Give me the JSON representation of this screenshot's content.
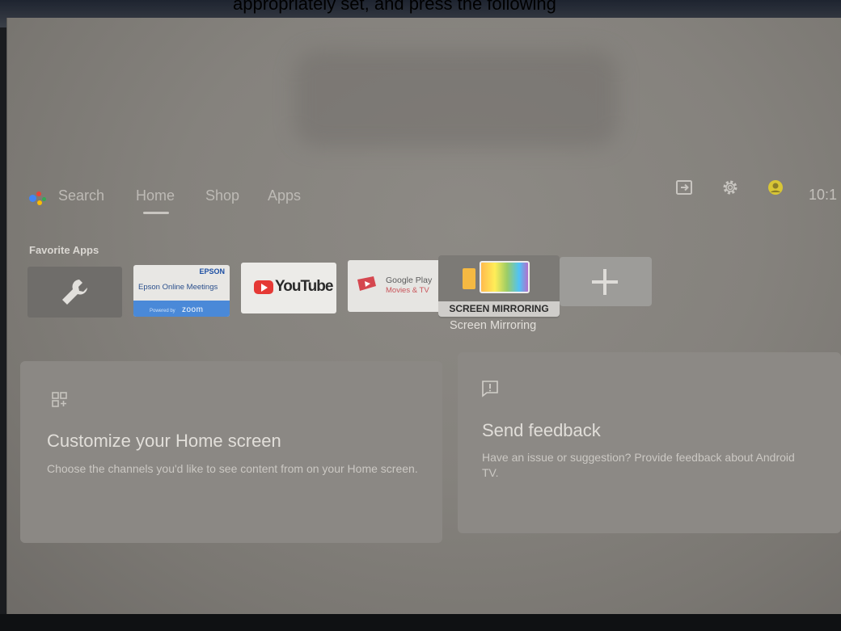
{
  "overlay_caption": "appropriately set, and press the following",
  "nav": {
    "search_label": "Search",
    "tabs": [
      {
        "label": "Home",
        "selected": true
      },
      {
        "label": "Shop",
        "selected": false
      },
      {
        "label": "Apps",
        "selected": false
      }
    ]
  },
  "top_right": {
    "icons": [
      "input-source-icon",
      "settings-gear-icon",
      "account-avatar-icon"
    ],
    "clock": "10:1"
  },
  "favorite_apps": {
    "title": "Favorite Apps",
    "apps": [
      {
        "name": "Settings",
        "icon": "wrench-icon"
      },
      {
        "brand": "EPSON",
        "name": "Epson Online Meetings",
        "powered": "Powered by",
        "partner": "zoom"
      },
      {
        "name": "YouTube"
      },
      {
        "line1": "Google Play",
        "line2": "Movies & TV"
      },
      {
        "focused_label": "SCREEN MIRRORING",
        "caption": "Screen Mirroring"
      },
      {
        "name": "Add app",
        "icon": "plus-icon"
      }
    ]
  },
  "cards": [
    {
      "title": "Customize your Home screen",
      "description": "Choose the channels you'd like to see content from on your Home screen.",
      "icon": "customize-grid-icon"
    },
    {
      "title": "Send feedback",
      "description": "Have an issue or suggestion? Provide feedback about Android TV.",
      "icon": "feedback-icon"
    }
  ],
  "colors": {
    "assistant_blue": "#4285f4",
    "assistant_red": "#ea4335",
    "assistant_yellow": "#fbbc05",
    "assistant_green": "#34a853",
    "avatar_yellow": "#d8c635"
  }
}
